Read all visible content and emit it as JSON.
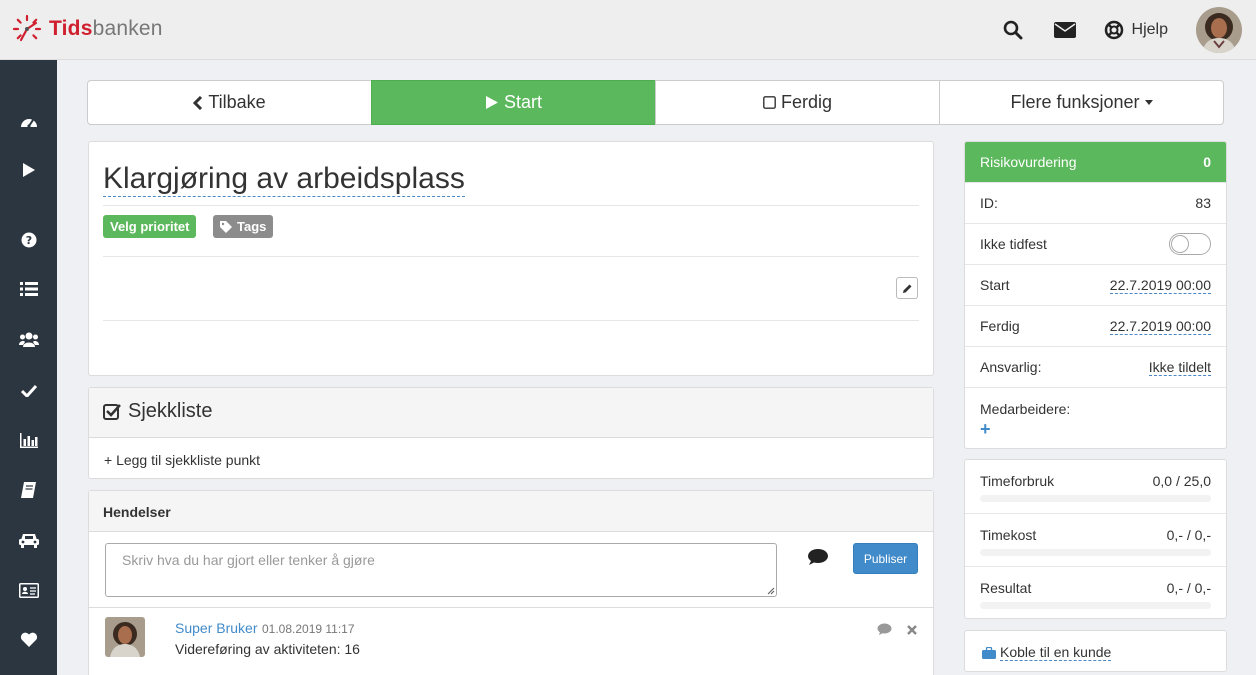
{
  "app": {
    "logo": {
      "brand_prefix": "Tids",
      "brand_suffix": "banken"
    },
    "help_label": "Hjelp"
  },
  "actions": {
    "back": "Tilbake",
    "start": "Start",
    "done": "Ferdig",
    "more": "Flere funksjoner"
  },
  "task": {
    "title": "Klargjøring av arbeidsplass",
    "priority_badge": "Velg prioritet",
    "tags_badge": "Tags"
  },
  "checklist": {
    "title": "Sjekkliste",
    "add_item": "+ Legg til sjekkliste punkt"
  },
  "events": {
    "title": "Hendelser",
    "placeholder": "Skriv hva du har gjort eller tenker å gjøre",
    "publish_label": "Publiser",
    "posts": [
      {
        "user": "Super Bruker",
        "time": "01.08.2019 11:17",
        "text": "Videreføring av aktiviteten: 16"
      }
    ]
  },
  "details": {
    "risk_label": "Risikovurdering",
    "risk_count": "0",
    "id_label": "ID:",
    "id_value": "83",
    "unscheduled_label": "Ikke tidfest",
    "unscheduled_on": false,
    "start_label": "Start",
    "start_value": "22.7.2019 00:00",
    "end_label": "Ferdig",
    "end_value": "22.7.2019 00:00",
    "responsible_label": "Ansvarlig:",
    "responsible_value": "Ikke tildelt",
    "coworkers_label": "Medarbeidere:",
    "coworkers_add": "+"
  },
  "time": {
    "rows": [
      {
        "label": "Timeforbruk",
        "value": "0,0 / 25,0",
        "progress": 0
      },
      {
        "label": "Timekost",
        "value": "0,- / 0,-",
        "progress": 0
      },
      {
        "label": "Resultat",
        "value": "0,- / 0,-",
        "progress": 0
      }
    ]
  },
  "customer": {
    "link_label": "Koble til en kunde"
  },
  "colors": {
    "accent_green": "#5cb85c",
    "primary_blue": "#428bca",
    "sidebar": "#2c3640",
    "brand_red": "#d0202f"
  },
  "icons": {
    "sidebar": [
      "dashboard-icon",
      "play-icon",
      "question-icon",
      "list-icon",
      "users-icon",
      "check-icon",
      "bar-chart-icon",
      "book-icon",
      "car-icon",
      "id-card-icon",
      "heart-icon"
    ]
  }
}
